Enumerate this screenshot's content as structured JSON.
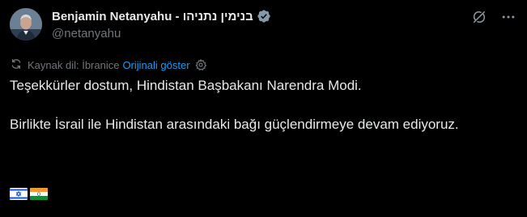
{
  "author": {
    "display_name": "Benjamin Netanyahu - בנימין נתניהו",
    "handle": "@netanyahu",
    "verified": true,
    "verified_color": "#829aab"
  },
  "translation": {
    "source_label": "Kaynak dil: İbranice",
    "show_original": "Orijinali göster"
  },
  "tweet": {
    "paragraph1": "Teşekkürler dostum, Hindistan Başbakanı Narendra Modi.",
    "paragraph2": "Birlikte İsrail ile Hindistan arasındaki bağı güçlendirmeye devam ediyoruz."
  },
  "flags": [
    "flag-israel",
    "flag-india"
  ],
  "icons": {
    "top_right": [
      "grok-icon",
      "more-icon"
    ],
    "translate": "translate-icon",
    "settings": "gear-icon"
  },
  "colors": {
    "background": "#000000",
    "text": "#e7e9ea",
    "muted": "#71767b",
    "link": "#1d9bf0"
  }
}
